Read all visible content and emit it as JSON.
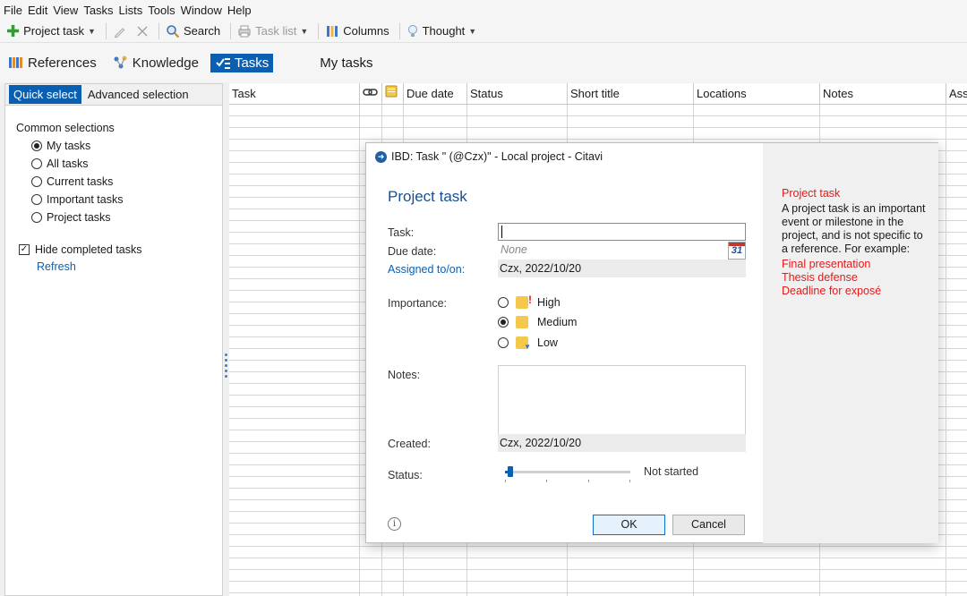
{
  "menu": [
    "File",
    "Edit",
    "View",
    "Tasks",
    "Lists",
    "Tools",
    "Window",
    "Help"
  ],
  "toolbar": {
    "project_task": "Project task",
    "search": "Search",
    "task_list": "Task list",
    "columns": "Columns",
    "thought": "Thought"
  },
  "nav": {
    "references": "References",
    "knowledge": "Knowledge",
    "tasks": "Tasks",
    "title": "My tasks"
  },
  "left_panel": {
    "tabs": [
      "Quick select",
      "Advanced selection"
    ],
    "heading": "Common selections",
    "options": [
      {
        "label": "My tasks",
        "checked": true
      },
      {
        "label": "All tasks",
        "checked": false
      },
      {
        "label": "Current tasks",
        "checked": false
      },
      {
        "label": "Important tasks",
        "checked": false
      },
      {
        "label": "Project tasks",
        "checked": false
      }
    ],
    "hide_completed": "Hide completed tasks",
    "hide_completed_checked": true,
    "refresh": "Refresh"
  },
  "grid": {
    "columns": [
      "Task",
      "",
      "",
      "Due date",
      "Status",
      "Short title",
      "Locations",
      "Notes",
      "Ass"
    ]
  },
  "dialog": {
    "title": "IBD: Task \" (@Czx)\" - Local project - Citavi",
    "heading": "Project task",
    "task_label": "Task:",
    "task_value": "",
    "due_label": "Due date:",
    "due_placeholder": "None",
    "calendar_day": "31",
    "assigned_label": "Assigned to/on:",
    "assigned_value": "Czx, 2022/10/20",
    "importance_label": "Importance:",
    "importance_options": [
      {
        "label": "High",
        "checked": false
      },
      {
        "label": "Medium",
        "checked": true
      },
      {
        "label": "Low",
        "checked": false
      }
    ],
    "notes_label": "Notes:",
    "notes_value": "",
    "created_label": "Created:",
    "created_value": "Czx, 2022/10/20",
    "status_label": "Status:",
    "status_value": "Not started",
    "status_progress": 0,
    "ok": "OK",
    "cancel": "Cancel",
    "info_glyph": "i",
    "side": {
      "title": "Project task",
      "description": "A project task is an important event or milestone in the project, and is not specific to a reference. For example:",
      "examples": [
        "Final presentation",
        "Thesis defense",
        "Deadline for exposé"
      ]
    }
  },
  "colors": {
    "accent": "#0b5fb0",
    "side_red": "#e21b1b"
  }
}
